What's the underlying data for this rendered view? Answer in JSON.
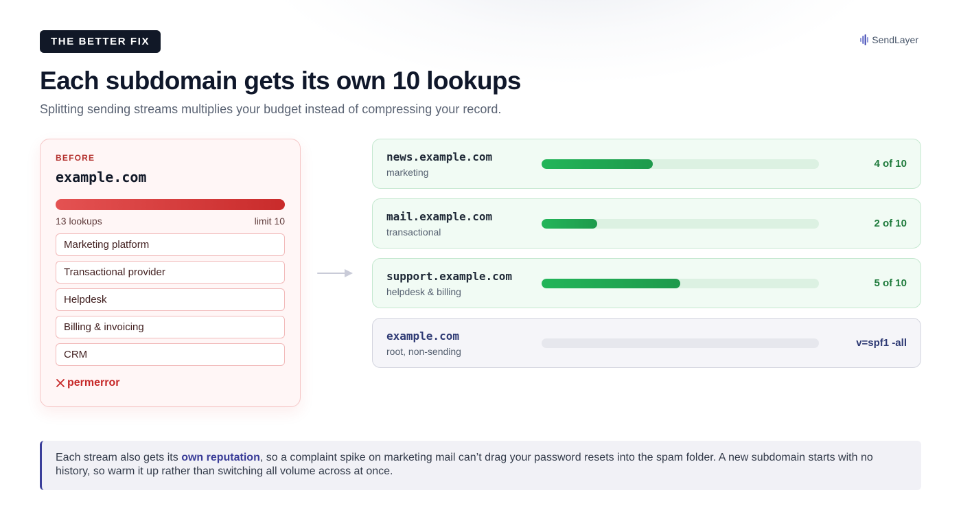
{
  "eyebrow": "THE BETTER FIX",
  "brand": "SendLayer",
  "title": "Each subdomain gets its own 10 lookups",
  "subtitle": "Splitting sending streams multiplies your budget instead of compressing your record.",
  "before": {
    "tag": "BEFORE",
    "domain": "example.com",
    "lookups_label": "13 lookups",
    "limit_label": "limit 10",
    "lookups": 13,
    "limit": 10,
    "items": [
      "Marketing platform",
      "Transactional provider",
      "Helpdesk",
      "Billing & invoicing",
      "CRM"
    ],
    "error_label": "permerror"
  },
  "subdomains": [
    {
      "domain": "news.example.com",
      "role": "marketing",
      "used": 4,
      "limit": 10,
      "label": "4 of 10"
    },
    {
      "domain": "mail.example.com",
      "role": "transactional",
      "used": 2,
      "limit": 10,
      "label": "2 of 10"
    },
    {
      "domain": "support.example.com",
      "role": "helpdesk & billing",
      "used": 5,
      "limit": 10,
      "label": "5 of 10"
    },
    {
      "domain": "example.com",
      "role": "root, non-sending",
      "used": 0,
      "limit": 10,
      "label": "v=spf1 -all"
    }
  ],
  "note": {
    "before": "Each stream also gets its ",
    "highlight": "own reputation",
    "after": ", so a complaint spike on marketing mail can’t drag your password resets into the spam folder. A new subdomain starts with no history, so warm it up rather than switching all volume across at once."
  },
  "colors": {
    "dark": "#111827",
    "red": "#c62828",
    "green": "#1e9a4c",
    "navy": "#2e3a74"
  }
}
